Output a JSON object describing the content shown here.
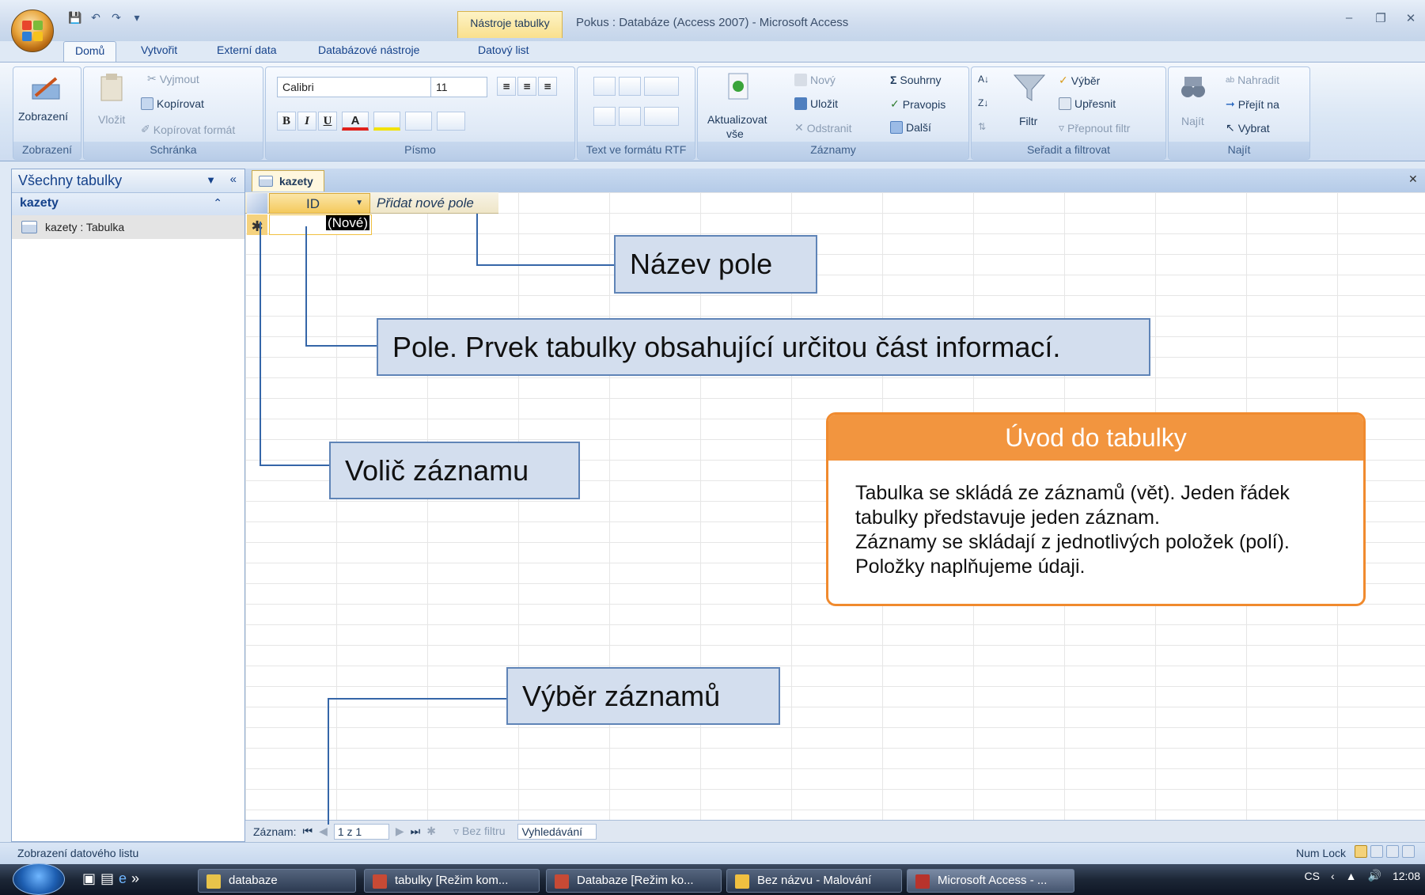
{
  "window": {
    "contextual_tab": "Nástroje tabulky",
    "title": "Pokus : Databáze (Access 2007) - Microsoft Access"
  },
  "tabs": [
    "Domů",
    "Vytvořit",
    "Externí data",
    "Databázové nástroje",
    "Datový list"
  ],
  "ribbon": {
    "zobrazeni": {
      "button": "Zobrazení",
      "label": "Zobrazení"
    },
    "schranka": {
      "vlozit": "Vložit",
      "vyjmout": "Vyjmout",
      "kopirovat": "Kopírovat",
      "kopirovat_format": "Kopírovat formát",
      "label": "Schránka"
    },
    "pismo": {
      "font": "Calibri",
      "size": "11",
      "bold": "B",
      "italic": "I",
      "underline": "U",
      "label": "Písmo"
    },
    "rtf": {
      "label": "Text ve formátu RTF"
    },
    "zaznamy": {
      "aktualizovat": "Aktualizovat",
      "vse": "vše",
      "novy": "Nový",
      "ulozit": "Uložit",
      "odstranit": "Odstranit",
      "souhrny": "Souhrny",
      "pravopis": "Pravopis",
      "dalsi": "Další",
      "label": "Záznamy"
    },
    "seradit": {
      "filtr": "Filtr",
      "vyber": "Výběr",
      "upresnit": "Upřesnit",
      "prepnout": "Přepnout filtr",
      "label": "Seřadit a filtrovat"
    },
    "najit": {
      "najit": "Najít",
      "nahradit": "Nahradit",
      "prejit": "Přejít na",
      "vybrat": "Vybrat",
      "label": "Najít"
    }
  },
  "nav": {
    "header": "Všechny tabulky",
    "group": "kazety",
    "item": "kazety : Tabulka"
  },
  "document": {
    "tab": "kazety",
    "id_header": "ID",
    "add_field": "Přidat nové pole",
    "new_value": "(Nové)"
  },
  "record_nav": {
    "label": "Záznam:",
    "position": "1 z 1",
    "filter": "Bez filtru",
    "search": "Vyhledávání"
  },
  "status": {
    "text": "Zobrazení datového listu",
    "numlock": "Num Lock"
  },
  "callouts": {
    "nazev_pole": "Název pole",
    "pole": "Pole. Prvek tabulky obsahující určitou část informací.",
    "volic": "Volič záznamu",
    "vyber": "Výběr záznamů"
  },
  "info": {
    "title": "Úvod do tabulky",
    "lines": [
      "Tabulka se skládá ze záznamů (vět). Jeden řádek",
      "tabulky představuje jeden záznam.",
      "Záznamy se skládají z jednotlivých položek (polí).",
      "Položky naplňujeme údaji."
    ]
  },
  "taskbar": {
    "items": [
      "databaze",
      "tabulky [Režim kom...",
      "Databaze [Režim ko...",
      "Bez názvu - Malování",
      "Microsoft Access - ..."
    ],
    "lang": "CS",
    "time": "12:08"
  }
}
